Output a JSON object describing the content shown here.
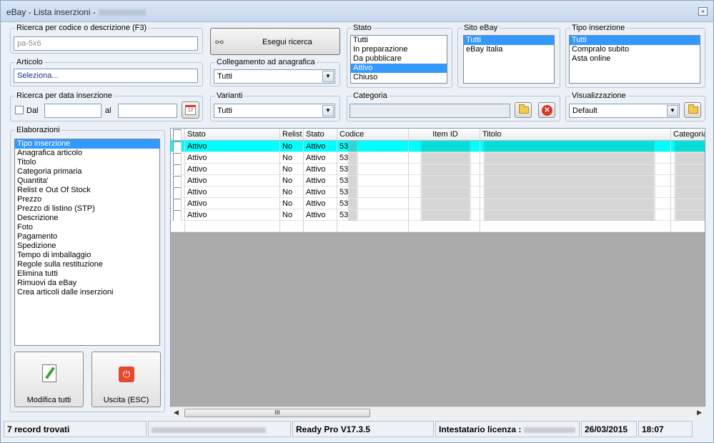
{
  "window": {
    "title": "eBay - Lista inserzioni -",
    "close_label": "×"
  },
  "search": {
    "legend": "Ricerca per codice o descrizione (F3)",
    "value": "pa-5x6"
  },
  "run_button": {
    "label": "Esegui ricerca",
    "icon": "binoculars-icon"
  },
  "article": {
    "legend": "Articolo",
    "value": "Seleziona..."
  },
  "link": {
    "legend": "Collegamento ad anagrafica",
    "value": "Tutti"
  },
  "stato": {
    "legend": "Stato",
    "items": [
      "Tutti",
      "In preparazione",
      "Da pubblicare",
      "Attivo",
      "Chiuso"
    ],
    "selected": 3
  },
  "sito": {
    "legend": "Sito eBay",
    "items": [
      "Tutti",
      "eBay Italia"
    ],
    "selected": 0
  },
  "tipo": {
    "legend": "Tipo inserzione",
    "items": [
      "Tutti",
      "Compralo subito",
      "Asta online"
    ],
    "selected": 0
  },
  "date": {
    "legend": "Ricerca per data inserzione",
    "from_label": "Dal",
    "to_label": "al",
    "calendar_text": "12"
  },
  "varianti": {
    "legend": "Varianti",
    "value": "Tutti"
  },
  "categoria": {
    "legend": "Categoria",
    "value": ""
  },
  "view": {
    "legend": "Visualizzazione",
    "value": "Default"
  },
  "elab": {
    "legend": "Elaborazioni",
    "items": [
      "Tipo inserzione",
      "Anagrafica articolo",
      "Titolo",
      "Categoria primaria",
      "Quantita'",
      "Relist e Out Of Stock",
      "Prezzo",
      "Prezzo di listino (STP)",
      "Descrizione",
      "Foto",
      "Pagamento",
      "Spedizione",
      "Tempo di imballaggio",
      "Regole sulla restituzione",
      "Elimina tutti",
      "Rimuovi da eBay",
      "Crea articoli dalle inserzioni"
    ],
    "selected": 0
  },
  "buttons": {
    "modify": "Modifica tutti",
    "exit": "Uscita (ESC)"
  },
  "grid": {
    "headers": [
      "",
      "Stato",
      "Relist",
      "Stato",
      "Codice",
      "Item ID",
      "Titolo",
      "Categoria"
    ],
    "rows": [
      {
        "stato": "Attivo",
        "relist": "No",
        "stato2": "Attivo",
        "codice": "53"
      },
      {
        "stato": "Attivo",
        "relist": "No",
        "stato2": "Attivo",
        "codice": "53"
      },
      {
        "stato": "Attivo",
        "relist": "No",
        "stato2": "Attivo",
        "codice": "53"
      },
      {
        "stato": "Attivo",
        "relist": "No",
        "stato2": "Attivo",
        "codice": "53"
      },
      {
        "stato": "Attivo",
        "relist": "No",
        "stato2": "Attivo",
        "codice": "53"
      },
      {
        "stato": "Attivo",
        "relist": "No",
        "stato2": "Attivo",
        "codice": "53"
      },
      {
        "stato": "Attivo",
        "relist": "No",
        "stato2": "Attivo",
        "codice": "53"
      }
    ],
    "selected_row": 0,
    "scroll_thumb_text": "III"
  },
  "status": {
    "records": "7 record trovati",
    "version": "Ready Pro V17.3.5",
    "license": "Intestatario licenza :",
    "date": "26/03/2015",
    "time": "18:07"
  },
  "colors": {
    "selection": "#3399ff",
    "row_highlight": "#00ffff",
    "grid_bg": "#ababab"
  }
}
